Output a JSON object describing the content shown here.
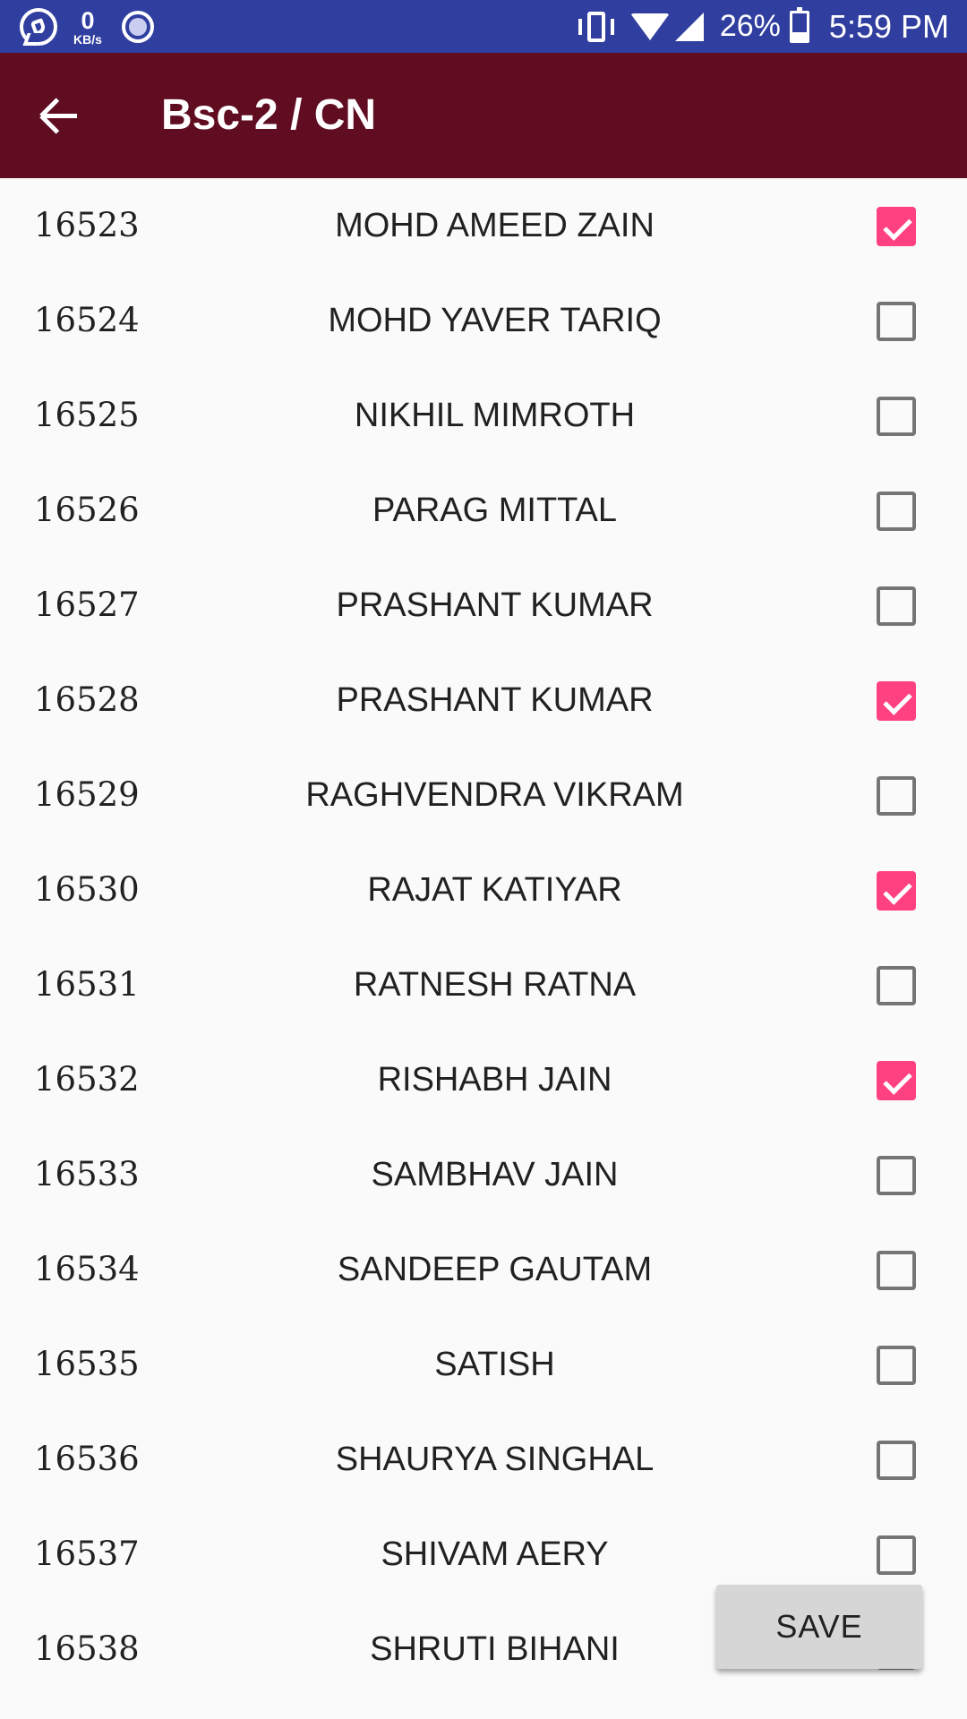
{
  "status_bar": {
    "net_speed_value": "0",
    "net_speed_unit": "KB/s",
    "battery_percent": "26%",
    "time": "5:59 PM",
    "icons": [
      "whatsapp-icon",
      "screen-record-icon",
      "vibrate-icon",
      "wifi-icon",
      "signal-icon",
      "battery-charging-icon"
    ]
  },
  "app_bar": {
    "title": "Bsc-2 / CN",
    "back_icon": "arrow-back-icon",
    "color": "#600c21"
  },
  "students": [
    {
      "roll": "16523",
      "name": "MOHD AMEED ZAIN",
      "checked": true
    },
    {
      "roll": "16524",
      "name": "MOHD YAVER TARIQ",
      "checked": false
    },
    {
      "roll": "16525",
      "name": "NIKHIL MIMROTH",
      "checked": false
    },
    {
      "roll": "16526",
      "name": "PARAG MITTAL",
      "checked": false
    },
    {
      "roll": "16527",
      "name": "PRASHANT KUMAR",
      "checked": false
    },
    {
      "roll": "16528",
      "name": "PRASHANT KUMAR",
      "checked": true
    },
    {
      "roll": "16529",
      "name": "RAGHVENDRA VIKRAM",
      "checked": false
    },
    {
      "roll": "16530",
      "name": "RAJAT KATIYAR",
      "checked": true
    },
    {
      "roll": "16531",
      "name": "RATNESH RATNA",
      "checked": false
    },
    {
      "roll": "16532",
      "name": "RISHABH JAIN",
      "checked": true
    },
    {
      "roll": "16533",
      "name": "SAMBHAV JAIN",
      "checked": false
    },
    {
      "roll": "16534",
      "name": "SANDEEP GAUTAM",
      "checked": false
    },
    {
      "roll": "16535",
      "name": "SATISH",
      "checked": false
    },
    {
      "roll": "16536",
      "name": "SHAURYA SINGHAL",
      "checked": false
    },
    {
      "roll": "16537",
      "name": "SHIVAM AERY",
      "checked": false
    },
    {
      "roll": "16538",
      "name": "SHRUTI BIHANI",
      "checked": false
    }
  ],
  "actions": {
    "save_label": "SAVE"
  },
  "colors": {
    "status_bar": "#303f9f",
    "accent": "#ff4081",
    "background": "#fafafa"
  }
}
